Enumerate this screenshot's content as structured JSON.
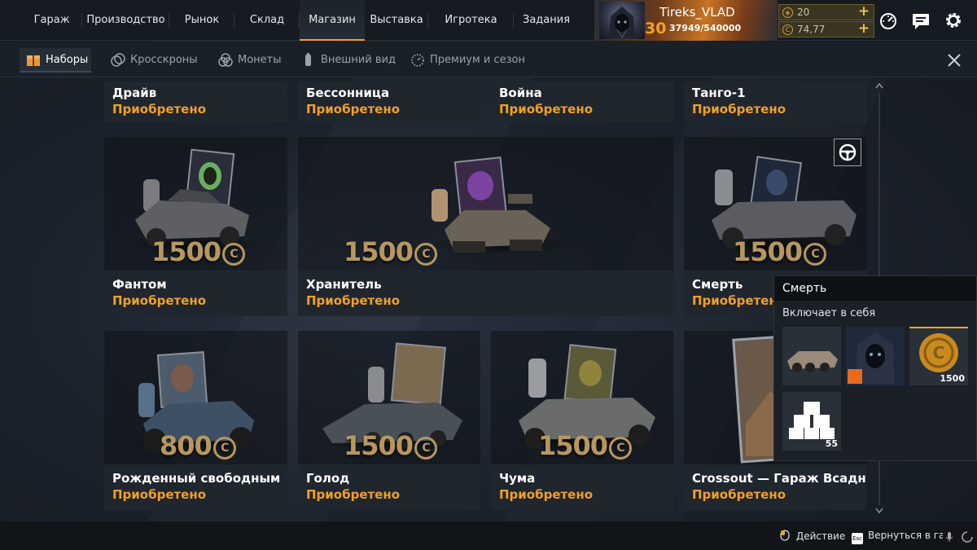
{
  "topnav": [
    {
      "label": "Гараж"
    },
    {
      "label": "Производство"
    },
    {
      "label": "Рынок"
    },
    {
      "label": "Склад"
    },
    {
      "label": "Магазин",
      "active": true
    },
    {
      "label": "Выставка"
    },
    {
      "label": "Игротека"
    },
    {
      "label": "Задания"
    }
  ],
  "profile": {
    "username": "Tireks_VLAD",
    "level": "30",
    "xp": "37949/540000"
  },
  "currency": {
    "premium": "20",
    "coins": "74,77"
  },
  "subtabs": [
    {
      "label": "Наборы",
      "active": true,
      "icon": "bundle-icon"
    },
    {
      "label": "Кросскроны",
      "icon": "crosscrowns-icon"
    },
    {
      "label": "Монеты",
      "icon": "coins-icon"
    },
    {
      "label": "Внешний вид",
      "icon": "paint-icon"
    },
    {
      "label": "Премиум и сезон",
      "icon": "premium-icon"
    }
  ],
  "cards": [
    {
      "title": "Драйв",
      "status": "Приобретено"
    },
    {
      "title": "Бессонница",
      "status": "Приобретено"
    },
    {
      "title": "Война",
      "status": "Приобретено"
    },
    {
      "title": "Танго-1",
      "status": "Приобретено"
    },
    {
      "title": "Фантом",
      "status": "Приобретено",
      "price": "1500"
    },
    {
      "title": "Хранитель",
      "status": "Приобретено",
      "price": "1500"
    },
    {
      "title": "Смерть",
      "status": "Приобретено",
      "price": "1500"
    },
    {
      "title": "Рожденный свободным",
      "status": "Приобретено",
      "price": "800"
    },
    {
      "title": "Голод",
      "status": "Приобретено",
      "price": "1500"
    },
    {
      "title": "Чума",
      "status": "Приобретено",
      "price": "1500"
    },
    {
      "title": "Crossout — Гараж Всадников",
      "status": "Приобретено"
    }
  ],
  "tooltip": {
    "title": "Смерть",
    "subtitle": "Включает в себя",
    "items": [
      {
        "icon": "vehicle-icon"
      },
      {
        "icon": "portrait-icon",
        "badge": "stickers-icon"
      },
      {
        "icon": "coin-icon",
        "count": "1500"
      },
      {
        "icon": "resources-icon",
        "count": "55"
      }
    ]
  },
  "footer": {
    "action": "Действие",
    "back": "Вернуться в гар",
    "esc_key": "Esc"
  },
  "colors": {
    "accent": "#f0a028",
    "price": "#b89660"
  }
}
